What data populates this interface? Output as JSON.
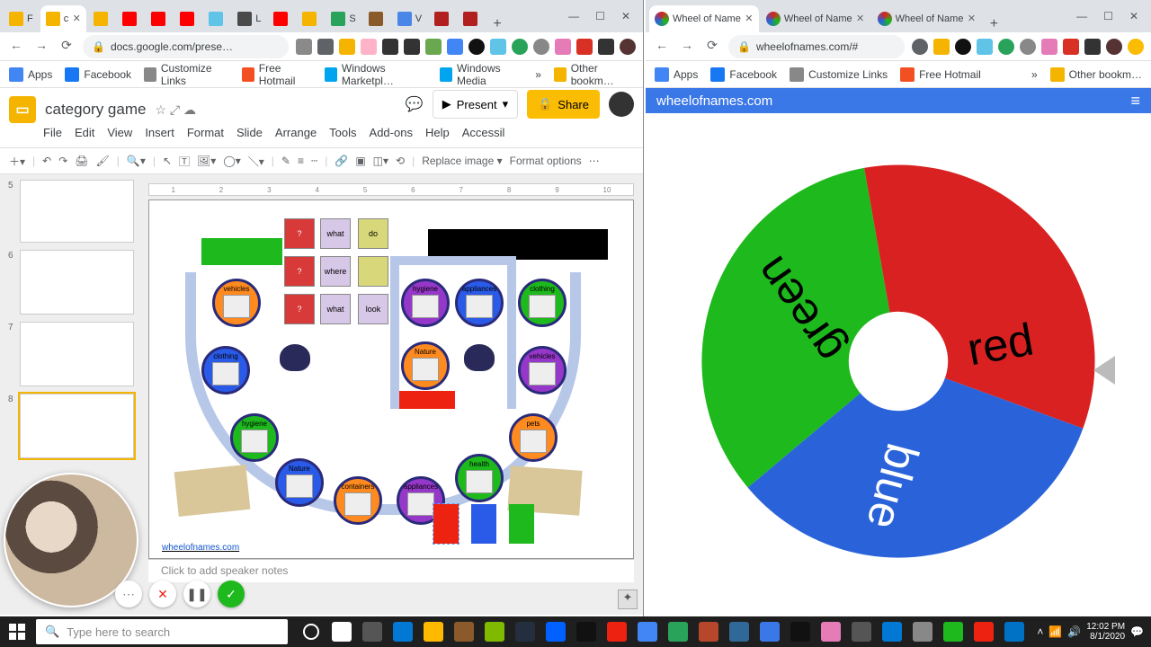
{
  "left_window": {
    "tabs": [
      {
        "fav": "#f4b400",
        "label": "F"
      },
      {
        "fav": "#f4b400",
        "label": "c",
        "active": true
      },
      {
        "fav": "#f4b400",
        "label": ""
      },
      {
        "fav": "#ff0000",
        "label": ""
      },
      {
        "fav": "#ff0000",
        "label": ""
      },
      {
        "fav": "#ff0000",
        "label": ""
      },
      {
        "fav": "#60c4e8",
        "label": ""
      },
      {
        "fav": "#4a4a4a",
        "label": "L"
      },
      {
        "fav": "#ff0000",
        "label": ""
      },
      {
        "fav": "#f4b400",
        "label": ""
      },
      {
        "fav": "#2aa35a",
        "label": "S"
      },
      {
        "fav": "#8a5a2a",
        "label": ""
      },
      {
        "fav": "#4a86e8",
        "label": "V"
      },
      {
        "fav": "#b21f1f",
        "label": ""
      },
      {
        "fav": "#b21f1f",
        "label": ""
      }
    ],
    "url": "docs.google.com/prese…",
    "bookmarks": [
      {
        "icon": "#4285f4",
        "label": "Apps"
      },
      {
        "icon": "#1877f2",
        "label": "Facebook"
      },
      {
        "icon": "#888888",
        "label": "Customize Links"
      },
      {
        "icon": "#f25022",
        "label": "Free Hotmail"
      },
      {
        "icon": "#00a4ef",
        "label": "Windows Marketpl…"
      },
      {
        "icon": "#00a4ef",
        "label": "Windows Media"
      }
    ],
    "bookmarks_more": "»",
    "bookmarks_other": "Other bookm…",
    "doc_title": "category game",
    "menus": [
      "File",
      "Edit",
      "View",
      "Insert",
      "Format",
      "Slide",
      "Arrange",
      "Tools",
      "Add-ons",
      "Help",
      "Accessil"
    ],
    "present_label": "Present",
    "share_label": "Share",
    "toolbar2": {
      "replace": "Replace image ▾",
      "format_options": "Format options"
    },
    "ruler_marks": [
      "1",
      "2",
      "3",
      "4",
      "5",
      "6",
      "7",
      "8",
      "9",
      "10"
    ],
    "slide_numbers": [
      "5",
      "6",
      "7",
      "8"
    ],
    "board": {
      "spots": [
        {
          "color": "#ff8a1f",
          "label": "vehicles"
        },
        {
          "color": "#2a5ae8",
          "label": "clothing"
        },
        {
          "color": "#1db91d",
          "label": "hygiene"
        },
        {
          "color": "#2a5ae8",
          "label": "Nature"
        },
        {
          "color": "#ff8a1f",
          "label": "containers"
        },
        {
          "color": "#9537c8",
          "label": "appliances"
        },
        {
          "color": "#1db91d",
          "label": "health"
        },
        {
          "color": "#ff8a1f",
          "label": "pets"
        },
        {
          "color": "#9537c8",
          "label": "vehicles"
        },
        {
          "color": "#1db91d",
          "label": "clothing"
        },
        {
          "color": "#2a5ae8",
          "label": "appliances"
        },
        {
          "color": "#9537c8",
          "label": "hygiene"
        },
        {
          "color": "#ff8a1f",
          "label": "Nature"
        }
      ],
      "card_labels": [
        "?",
        "what",
        "do",
        "?",
        "where",
        "",
        "?",
        "what",
        "look"
      ]
    },
    "link_text": "wheelofnames.com",
    "speaker_notes": "Click to add speaker notes"
  },
  "right_window": {
    "tabs": [
      {
        "label": "Wheel of Name",
        "active": true
      },
      {
        "label": "Wheel of Name",
        "active": false
      },
      {
        "label": "Wheel of Name",
        "active": false
      }
    ],
    "url": "wheelofnames.com/#",
    "bookmarks": [
      {
        "icon": "#4285f4",
        "label": "Apps"
      },
      {
        "icon": "#1877f2",
        "label": "Facebook"
      },
      {
        "icon": "#888888",
        "label": "Customize Links"
      },
      {
        "icon": "#f25022",
        "label": "Free Hotmail"
      }
    ],
    "bookmarks_more": "»",
    "bookmarks_other": "Other bookm…",
    "site_title": "wheelofnames.com",
    "wheel": {
      "segments": [
        {
          "label": "green",
          "color": "#1db91d"
        },
        {
          "label": "red",
          "color": "#d92121"
        },
        {
          "label": "blue",
          "color": "#2a63d9"
        }
      ]
    }
  },
  "taskbar": {
    "search_placeholder": "Type here to search",
    "time": "12:02 PM",
    "date": "8/1/2020"
  },
  "chart_data": {
    "type": "pie",
    "title": "",
    "series": [
      {
        "name": "green",
        "value": 1,
        "color": "#1db91d"
      },
      {
        "name": "red",
        "value": 1,
        "color": "#d92121"
      },
      {
        "name": "blue",
        "value": 1,
        "color": "#2a63d9"
      }
    ]
  }
}
